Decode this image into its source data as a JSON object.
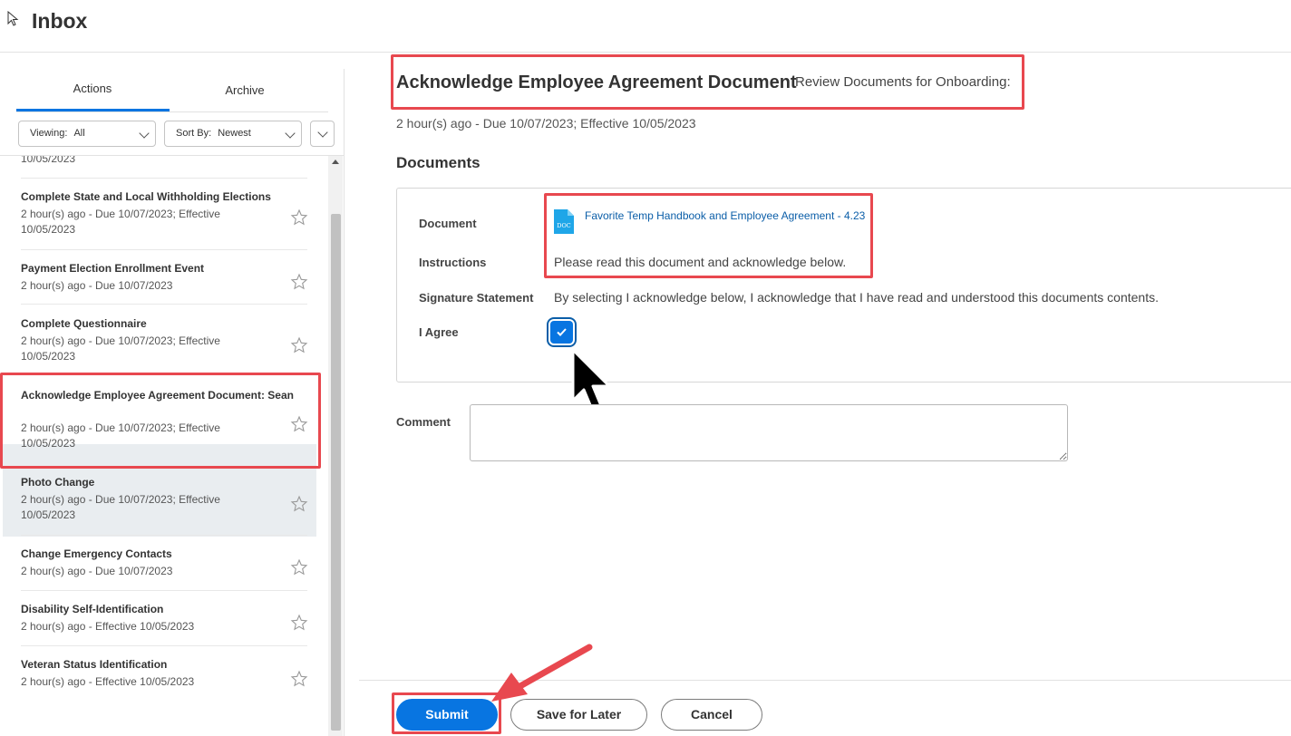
{
  "header": {
    "title": "Inbox"
  },
  "tabs": {
    "actions": "Actions",
    "archive": "Archive"
  },
  "filters": {
    "viewing_label": "Viewing:",
    "viewing_value": "All",
    "sort_label": "Sort By:",
    "sort_value": "Newest"
  },
  "list": {
    "cut_off_date": "10/05/2023",
    "items": [
      {
        "title": "Complete State and Local Withholding Elections",
        "sub": "2 hour(s) ago - Due 10/07/2023; Effective 10/05/2023"
      },
      {
        "title": "Payment Election Enrollment Event",
        "sub": "2 hour(s) ago - Due 10/07/2023"
      },
      {
        "title": "Complete Questionnaire",
        "sub": "2 hour(s) ago - Due 10/07/2023; Effective 10/05/2023"
      },
      {
        "title": "Acknowledge Employee Agreement Document: Sean",
        "sub": "2 hour(s) ago - Due 10/07/2023; Effective 10/05/2023",
        "selected": true
      },
      {
        "title": "Photo Change",
        "sub": "2 hour(s) ago - Due 10/07/2023; Effective 10/05/2023"
      },
      {
        "title": "Change Emergency Contacts",
        "sub": "2 hour(s) ago - Due 10/07/2023"
      },
      {
        "title": "Disability Self-Identification",
        "sub": "2 hour(s) ago - Effective 10/05/2023"
      },
      {
        "title": "Veteran Status Identification",
        "sub": "2 hour(s) ago - Effective 10/05/2023"
      }
    ]
  },
  "task": {
    "title": "Acknowledge Employee Agreement Document",
    "subtitle": "Review Documents for Onboarding:",
    "meta": "2 hour(s) ago - Due 10/07/2023; Effective 10/05/2023",
    "section": "Documents",
    "document_label": "Document",
    "document_name": "Favorite Temp Handbook and Employee Agreement - 4.23",
    "doc_icon_text": "DOC",
    "instructions_label": "Instructions",
    "instructions": "Please read this document and acknowledge below.",
    "signature_label": "Signature Statement",
    "signature": "By selecting I acknowledge below, I acknowledge that I have read and understood this documents contents.",
    "agree_label": "I Agree",
    "agree_checked": true,
    "comment_label": "Comment",
    "comment_value": ""
  },
  "footer": {
    "submit": "Submit",
    "save": "Save for Later",
    "cancel": "Cancel"
  },
  "colors": {
    "accent": "#0875e1",
    "highlight": "#e8484f",
    "link": "#0b5ea8"
  }
}
